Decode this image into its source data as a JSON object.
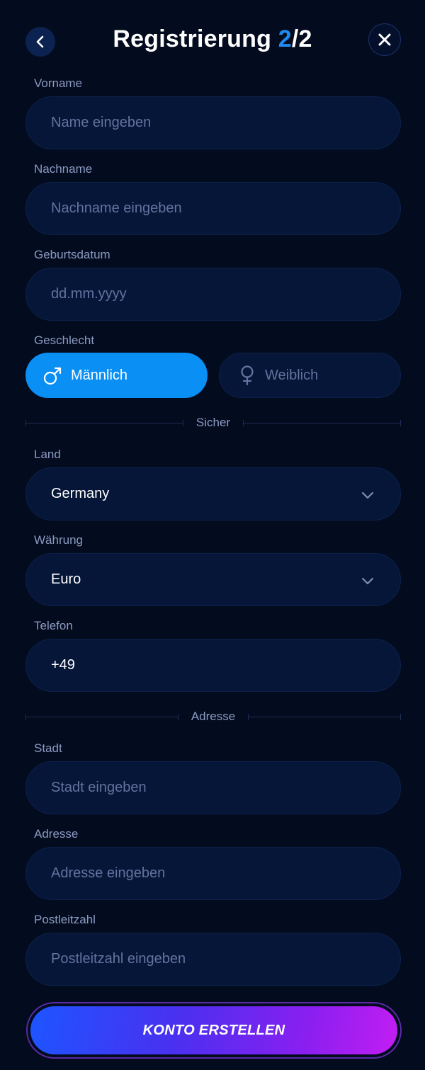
{
  "header": {
    "title_main": "Registrierung ",
    "title_step": "2",
    "title_total": "/2"
  },
  "form": {
    "first_name": {
      "label": "Vorname",
      "placeholder": "Name eingeben",
      "value": ""
    },
    "last_name": {
      "label": "Nachname",
      "placeholder": "Nachname eingeben",
      "value": ""
    },
    "birthdate": {
      "label": "Geburtsdatum",
      "placeholder": "dd.mm.yyyy",
      "value": ""
    },
    "gender": {
      "label": "Geschlecht",
      "options": [
        {
          "label": "Männlich",
          "selected": true
        },
        {
          "label": "Weiblich",
          "selected": false
        }
      ]
    },
    "section_secure": "Sicher",
    "country": {
      "label": "Land",
      "value": "Germany"
    },
    "currency": {
      "label": "Währung",
      "value": "Euro"
    },
    "phone": {
      "label": "Telefon",
      "placeholder": "",
      "value": "+49"
    },
    "section_address": "Adresse",
    "city": {
      "label": "Stadt",
      "placeholder": "Stadt eingeben",
      "value": ""
    },
    "address": {
      "label": "Adresse",
      "placeholder": "Adresse eingeben",
      "value": ""
    },
    "postal_code": {
      "label": "Postleitzahl",
      "placeholder": "Postleitzahl eingeben",
      "value": ""
    },
    "submit_label": "KONTO ERSTELLEN"
  },
  "icons": {
    "back": "chevron-left-icon",
    "close": "close-icon",
    "male": "male-symbol-icon",
    "female": "female-symbol-icon",
    "dropdown": "chevron-down-icon"
  },
  "colors": {
    "background": "#030b1e",
    "field": "#061638",
    "accent": "#1f8bf0",
    "selected_gender": "#0a8ff5",
    "submit_gradient_start": "#1d55ff",
    "submit_gradient_end": "#c21ef2"
  }
}
